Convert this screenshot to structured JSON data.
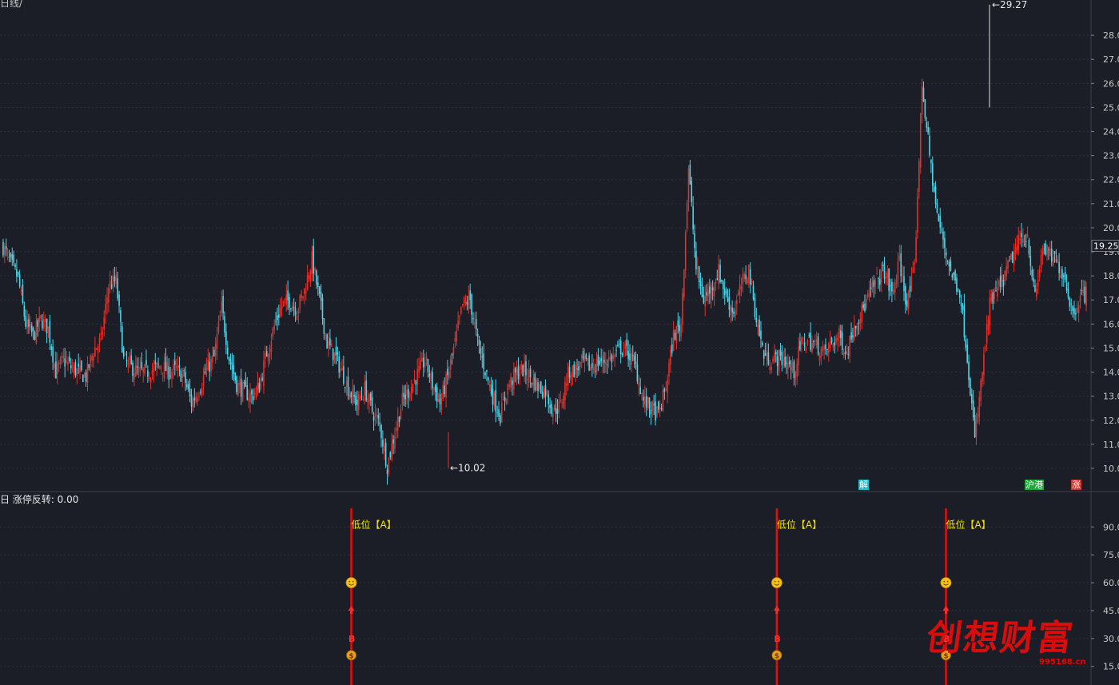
{
  "window": {
    "title": "日线/"
  },
  "price_panel": {
    "last_price": "19.25",
    "high_label": "29.27",
    "low_label": "10.02",
    "tags": [
      {
        "text": "解",
        "color": "#1fb7c9"
      },
      {
        "text": "沪港",
        "color": "#1fa83a"
      },
      {
        "text": "涨",
        "color": "#c8342b"
      }
    ]
  },
  "indicator_panel": {
    "title": "日 涨停反转: 0.00",
    "signal_label": "低位【A】"
  },
  "watermark": {
    "text": "创想财富",
    "url": "995168.cn"
  },
  "colors": {
    "up": "#e0312c",
    "down": "#52d3e6",
    "signal": "#e01010",
    "label": "#f2e600",
    "grid": "#2d3340"
  },
  "chart_data": [
    {
      "type": "candlestick",
      "ylim": [
        9.6,
        29.3
      ],
      "yticks": [
        "28.0",
        "27.0",
        "26.0",
        "25.0",
        "24.0",
        "23.0",
        "22.0",
        "21.0",
        "20.0",
        "19.0",
        "18.0",
        "17.0",
        "16.0",
        "15.0",
        "14.0",
        "13.0",
        "12.0",
        "11.0",
        "10.0"
      ],
      "approx_close_path": [
        19.2,
        18.5,
        17.9,
        16.0,
        15.5,
        16.2,
        15.8,
        14.0,
        14.5,
        14.2,
        14.0,
        13.8,
        14.9,
        15.3,
        17.6,
        17.8,
        14.5,
        14.2,
        14.0,
        14.0,
        14.1,
        14.3,
        14.0,
        14.1,
        13.8,
        12.7,
        13.3,
        14.1,
        14.6,
        16.7,
        14.6,
        13.5,
        13.2,
        13.0,
        13.4,
        14.8,
        15.9,
        16.8,
        17.0,
        16.6,
        17.4,
        18.7,
        17.0,
        15.2,
        14.7,
        14.0,
        13.2,
        12.7,
        13.3,
        12.4,
        11.8,
        10.1,
        11.5,
        12.8,
        13.3,
        13.9,
        14.5,
        13.5,
        12.7,
        13.8,
        15.2,
        16.8,
        17.0,
        15.2,
        14.1,
        13.0,
        12.2,
        13.4,
        13.9,
        14.1,
        13.8,
        13.4,
        13.2,
        12.4,
        12.6,
        14.0,
        14.1,
        14.4,
        14.2,
        14.4,
        14.5,
        14.6,
        15.0,
        14.8,
        14.2,
        12.8,
        12.5,
        12.2,
        13.4,
        15.5,
        16.0,
        22.5,
        18.3,
        17.0,
        17.5,
        18.2,
        17.1,
        16.5,
        17.6,
        18.3,
        16.2,
        14.7,
        14.5,
        14.6,
        14.4,
        14.0,
        15.2,
        15.3,
        15.1,
        14.8,
        15.2,
        15.5,
        14.8,
        16.0,
        16.5,
        17.2,
        17.8,
        18.2,
        17.2,
        18.6,
        16.8,
        18.3,
        26.0,
        23.0,
        20.5,
        19.2,
        18.0,
        17.4,
        14.7,
        11.2,
        14.0,
        16.8,
        17.4,
        18.0,
        18.8,
        19.5,
        19.7,
        17.0,
        19.2,
        18.8,
        18.5,
        17.9,
        16.4,
        17.2
      ],
      "annotations": {
        "high": 29.27,
        "low": 10.02,
        "last": 19.25
      }
    },
    {
      "type": "signal",
      "title": "涨停反转",
      "value": 0.0,
      "ylim": [
        5,
        100
      ],
      "yticks": [
        "90.0",
        "75.0",
        "60.0",
        "45.0",
        "30.0",
        "15.0"
      ],
      "signal_fraction_x": [
        0.322,
        0.712,
        0.867
      ],
      "levels": {
        "label": 90,
        "smiley": 60,
        "arrow": 45,
        "B": 30,
        "money": 21
      }
    }
  ]
}
